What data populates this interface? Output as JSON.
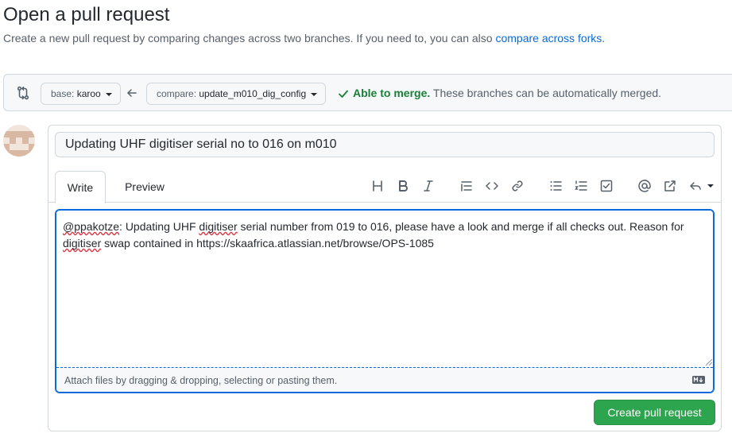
{
  "header": {
    "title": "Open a pull request",
    "subtitle_text": "Create a new pull request by comparing changes across two branches. If you need to, you can also ",
    "subtitle_link": "compare across forks",
    "subtitle_end": "."
  },
  "compare": {
    "base_prefix": "base: ",
    "base_branch": "karoo",
    "compare_prefix": "compare: ",
    "compare_branch": "update_m010_dig_config",
    "merge_status_bold": "Able to merge.",
    "merge_status_text": " These branches can be automatically merged."
  },
  "form": {
    "title_value": "Updating UHF digitiser serial no to 016 on m010",
    "tabs": [
      {
        "label": "Write"
      },
      {
        "label": "Preview"
      }
    ],
    "toolbar": [
      "heading-icon",
      "bold-icon",
      "italic-icon",
      "quote-icon",
      "code-icon",
      "link-icon",
      "unordered-list-icon",
      "ordered-list-icon",
      "task-list-icon",
      "mention-icon",
      "cross-reference-icon",
      "saved-replies-icon"
    ],
    "body_parts": {
      "mention": "@ppakotze",
      "p1": ": Updating UHF ",
      "w1": "digitiser",
      "p2": " serial number from 019 to 016, please have a look and merge if all checks out. Reason for ",
      "w2": "digitiser",
      "p3": " swap contained in https://skaafrica.atlassian.net/browse/OPS-1085"
    },
    "attach_text": "Attach files by dragging & dropping, selecting or pasting them.",
    "submit_label": "Create pull request"
  },
  "colors": {
    "accent": "#0969da",
    "success": "#1a7f37",
    "button_green": "#2da44e"
  }
}
